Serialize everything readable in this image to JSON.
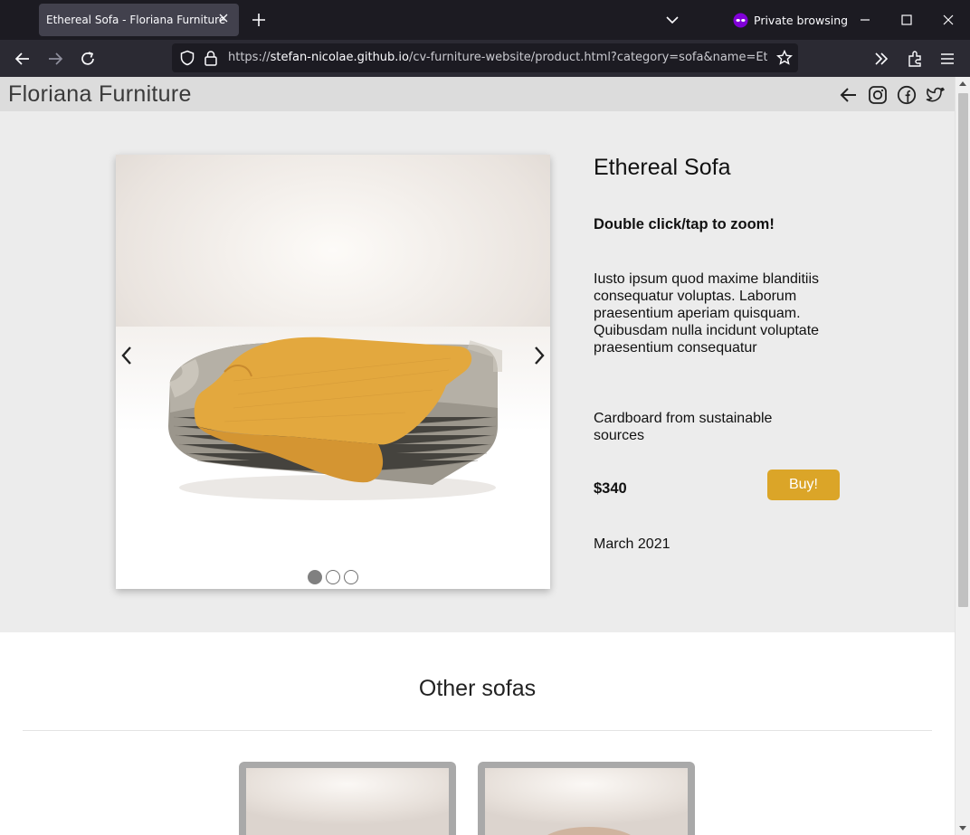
{
  "browser": {
    "tab_title": "Ethereal Sofa - Floriana Furniture",
    "private_label": "Private browsing",
    "url_prefix": "https://",
    "url_host": "stefan-nicolae.github.io",
    "url_path": "/cv-furniture-website/product.html?category=sofa&name=Ethereal"
  },
  "site": {
    "brand": "Floriana Furniture",
    "header_icons": [
      "back-arrow-icon",
      "instagram-icon",
      "facebook-icon",
      "twitter-icon"
    ]
  },
  "product": {
    "title": "Ethereal Sofa",
    "zoom_hint": "Double click/tap to zoom!",
    "description": "Iusto ipsum quod maxime blanditiis consequatur voluptas. Laborum praesentium aperiam quisquam. Quibusdam nulla incidunt voluptate praesentium consequatur",
    "material": "Cardboard from sustainable sources",
    "price": "$340",
    "buy_label": "Buy!",
    "date": "March 2021",
    "carousel": {
      "image_count": 3,
      "active_index": 0
    },
    "colors": {
      "buy_button": "#dba528",
      "sofa_blanket": "#e3a83e"
    }
  },
  "others": {
    "heading": "Other sofas",
    "card_count": 2
  }
}
